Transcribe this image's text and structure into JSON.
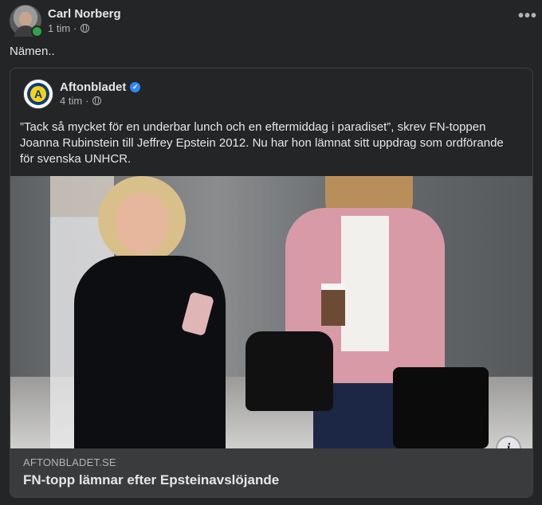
{
  "post": {
    "author": "Carl Norberg",
    "time": "1 tim",
    "separator": "·",
    "text": "Nämen..",
    "more_label": "•••"
  },
  "shared": {
    "page_name": "Aftonbladet",
    "logo_letter": "A",
    "time": "4 tim",
    "separator": "·",
    "body": "”Tack så mycket för en underbar lunch och en eftermiddag i paradiset”, skrev FN-toppen Joanna Rubinstein till Jeffrey Epstein 2012. Nu har hon lämnat sitt uppdrag som ordförande för svenska UNHCR.",
    "link": {
      "domain": "AFTONBLADET.SE",
      "title": "FN-topp lämnar efter Epsteinavslöjande"
    },
    "info_label": "i"
  },
  "icons": {
    "privacy": "globe-icon",
    "verified": "verified-badge-icon",
    "more": "more-options-icon",
    "info": "info-icon"
  },
  "colors": {
    "background": "#242526",
    "link_footer": "#3a3b3c",
    "verified": "#2d88ff",
    "online": "#31a24c"
  }
}
